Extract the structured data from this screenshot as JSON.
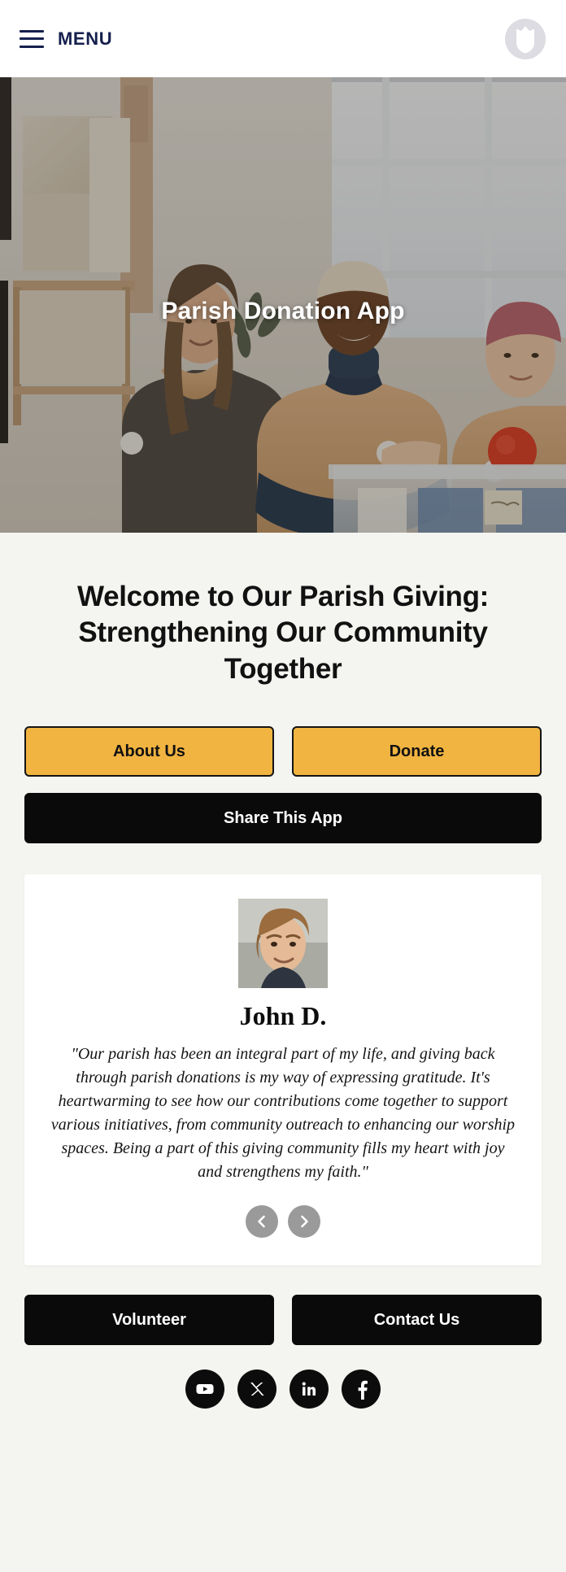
{
  "nav": {
    "menu_label": "MENU",
    "menu_icon": "hamburger-icon",
    "logo_icon": "parish-shield-logo"
  },
  "hero": {
    "title": "Parish Donation App",
    "image_alt": "Three smiling volunteers in tan shirts standing behind a clear donation bin filled with clothing in a donation center"
  },
  "main": {
    "welcome_heading": "Welcome to Our Parish Giving: Strengthening Our Community Together",
    "buttons": {
      "about": "About Us",
      "donate": "Donate",
      "share": "Share This App"
    }
  },
  "testimonial": {
    "author": "John D.",
    "avatar_alt": "Portrait photo of a young man with light brown hair smiling",
    "quote": "\"Our parish has been an integral part of my life, and giving back through parish donations is my way of expressing gratitude. It's heartwarming to see how our contributions come together to support various initiatives, from community outreach to enhancing our worship spaces. Being a part of this giving community fills my heart with joy and strengthens my faith.\"",
    "prev_icon": "chevron-left-icon",
    "next_icon": "chevron-right-icon"
  },
  "footer": {
    "buttons": {
      "volunteer": "Volunteer",
      "contact": "Contact Us"
    },
    "socials": [
      {
        "name": "youtube-icon",
        "label": "YouTube"
      },
      {
        "name": "x-icon",
        "label": "X"
      },
      {
        "name": "linkedin-icon",
        "label": "LinkedIn"
      },
      {
        "name": "facebook-icon",
        "label": "Facebook"
      }
    ]
  },
  "colors": {
    "page_background": "#f4f4f0",
    "nav_background": "#ffffff",
    "nav_text": "#16204e",
    "accent_amber": "#f1b441",
    "dark_button": "#0a0a0a",
    "card_background": "#ffffff",
    "carousel_button": "#9a9a9a"
  }
}
